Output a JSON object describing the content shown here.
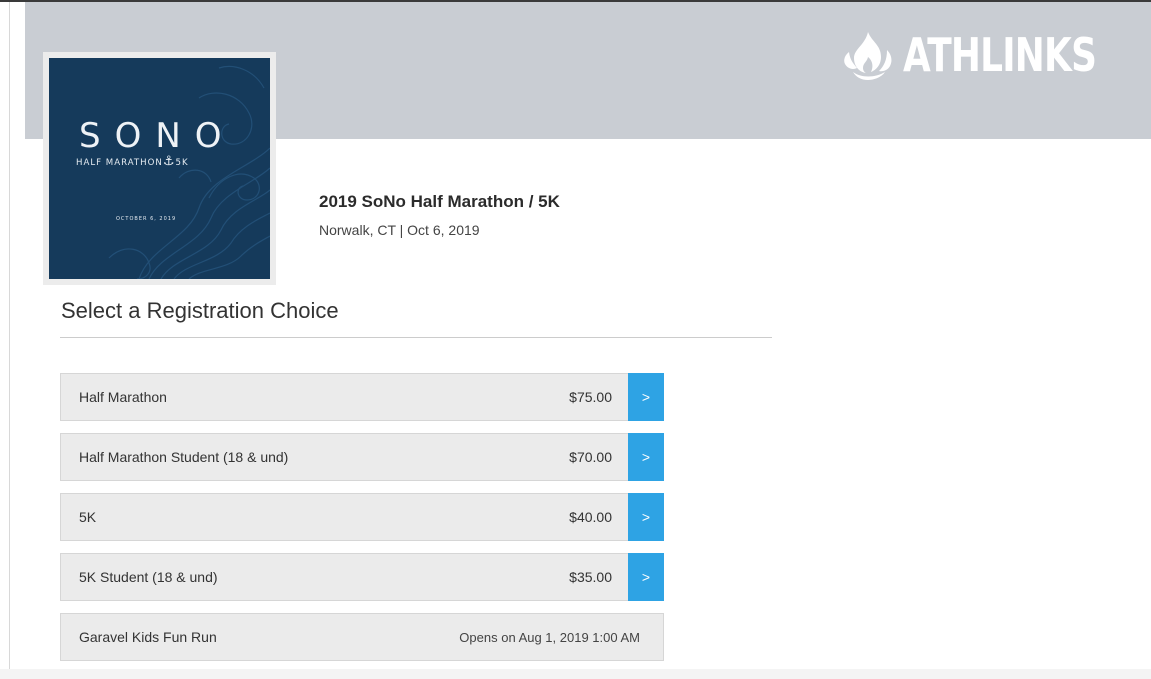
{
  "brand": {
    "name": "ATHLINKS",
    "icon": "flame-icon",
    "color": "#ffffff"
  },
  "event_logo": {
    "word": "SONO",
    "subtitle_left": "HALF MARATHON",
    "subtitle_right": "5K",
    "date": "OCTOBER 6, 2019",
    "background": "#153a5b"
  },
  "event": {
    "title": "2019 SoNo Half Marathon / 5K",
    "meta": "Norwalk, CT | Oct 6, 2019"
  },
  "section": {
    "title": "Select a Registration Choice"
  },
  "choices": [
    {
      "name": "Half Marathon",
      "price": "$75.00",
      "action": ">"
    },
    {
      "name": "Half Marathon Student (18 & und)",
      "price": "$70.00",
      "action": ">"
    },
    {
      "name": "5K",
      "price": "$40.00",
      "action": ">"
    },
    {
      "name": "5K Student (18 & und)",
      "price": "$35.00",
      "action": ">"
    },
    {
      "name": "Garavel Kids Fun Run",
      "status": "Opens on Aug 1, 2019 1:00 AM"
    }
  ],
  "colors": {
    "header_band": "#c9cdd3",
    "accent": "#2ea3e4",
    "row_bg": "#ebebeb"
  }
}
